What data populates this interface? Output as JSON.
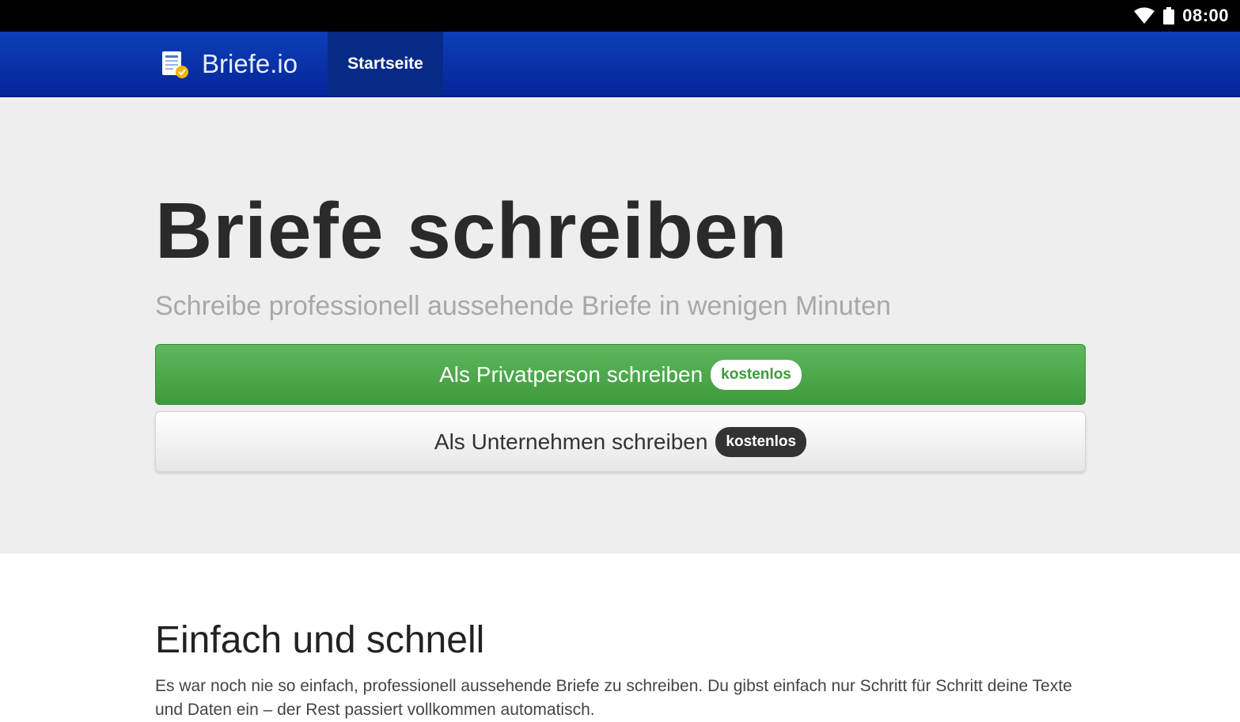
{
  "status_bar": {
    "time": "08:00",
    "icons": [
      "wifi-icon",
      "battery-icon"
    ]
  },
  "navbar": {
    "brand": "Briefe.io",
    "brand_icon": "letter-logo-icon",
    "tabs": [
      {
        "label": "Startseite",
        "active": true
      }
    ]
  },
  "hero": {
    "title": "Briefe schreiben",
    "subtitle": "Schreibe professionell aussehende Briefe in wenigen Minuten",
    "buttons": [
      {
        "label": "Als Privatperson schreiben",
        "badge": "kostenlos",
        "style": "success"
      },
      {
        "label": "Als Unternehmen schreiben",
        "badge": "kostenlos",
        "style": "default"
      }
    ]
  },
  "section": {
    "title": "Einfach und schnell",
    "text": "Es war noch nie so einfach, professionell aussehende Briefe zu schreiben. Du gibst einfach nur Schritt für Schritt deine Texte und Daten ein – der Rest passiert vollkommen automatisch."
  },
  "colors": {
    "navbar": "#0d3fb8",
    "nav_tab_active": "#072a86",
    "success": "#4caf50",
    "hero_bg": "#eeeeee"
  }
}
